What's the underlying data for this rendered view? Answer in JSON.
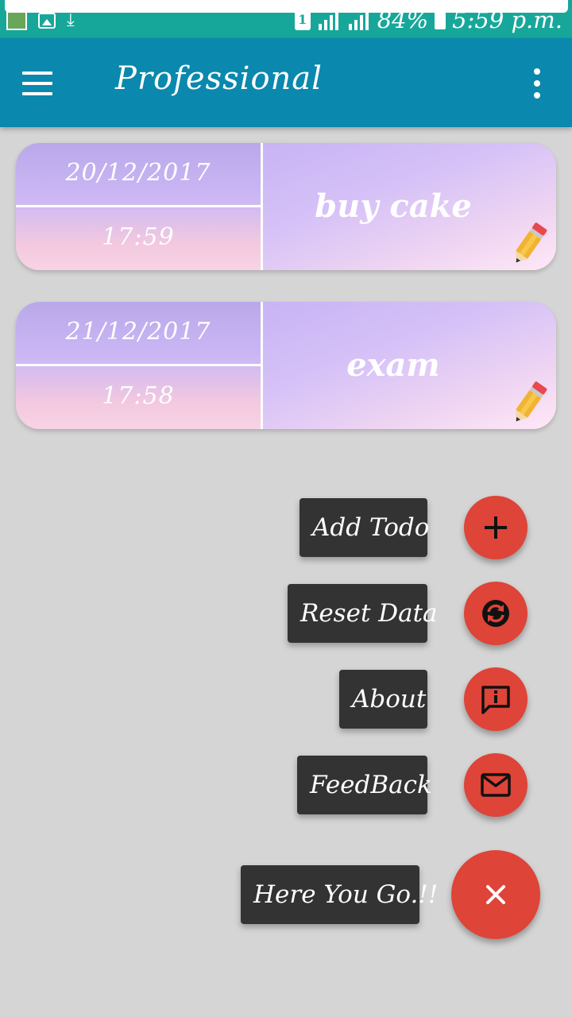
{
  "status_bar": {
    "sim": "1",
    "battery": "84%",
    "time": "5:59 p.m."
  },
  "app_bar": {
    "title": "Professional"
  },
  "todos": [
    {
      "date": "20/12/2017",
      "time": "17:59",
      "task": "buy cake"
    },
    {
      "date": "21/12/2017",
      "time": "17:58",
      "task": "exam"
    }
  ],
  "fab_menu": {
    "add_label": "Add Todo",
    "reset_label": "Reset Data",
    "about_label": "About",
    "feedback_label": "FeedBack",
    "main_label": "Here You Go.!!"
  },
  "colors": {
    "status_bar": "#17a79a",
    "app_bar": "#0b88ad",
    "fab": "#de4437",
    "label_bg": "#333333",
    "background": "#d5d5d5"
  }
}
